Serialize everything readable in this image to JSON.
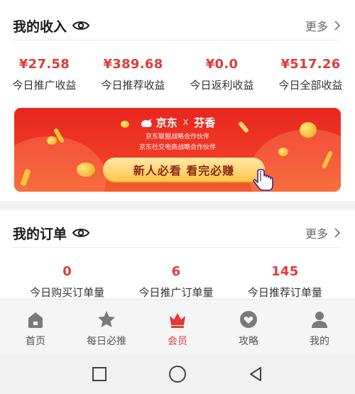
{
  "income": {
    "title": "我的收入",
    "more": "更多",
    "stats": [
      {
        "value": "¥27.58",
        "label": "今日推广收益"
      },
      {
        "value": "¥389.68",
        "label": "今日推荐收益"
      },
      {
        "value": "¥0.0",
        "label": "今日返利收益"
      },
      {
        "value": "¥517.26",
        "label": "今日全部收益"
      }
    ]
  },
  "banner": {
    "brand_left": "京东",
    "brand_x": "X",
    "brand_right": "芬香",
    "line1": "京东联盟战略合作伙伴",
    "line2": "京东社交电商战略合作伙伴",
    "cta": "新人必看  看完必赚"
  },
  "orders": {
    "title": "我的订单",
    "more": "更多",
    "stats": [
      {
        "value": "0",
        "label": "今日购买订单量"
      },
      {
        "value": "6",
        "label": "今日推广订单量"
      },
      {
        "value": "145",
        "label": "今日推荐订单量"
      }
    ]
  },
  "tabs": [
    {
      "label": "首页",
      "icon": "home-icon"
    },
    {
      "label": "每日必推",
      "icon": "star-icon"
    },
    {
      "label": "会员",
      "icon": "crown-icon",
      "active": true
    },
    {
      "label": "攻略",
      "icon": "heart-icon"
    },
    {
      "label": "我的",
      "icon": "person-icon"
    }
  ],
  "colors": {
    "accent": "#e03a3a",
    "banner": "#ee3424",
    "cta": "#ffd25e"
  }
}
